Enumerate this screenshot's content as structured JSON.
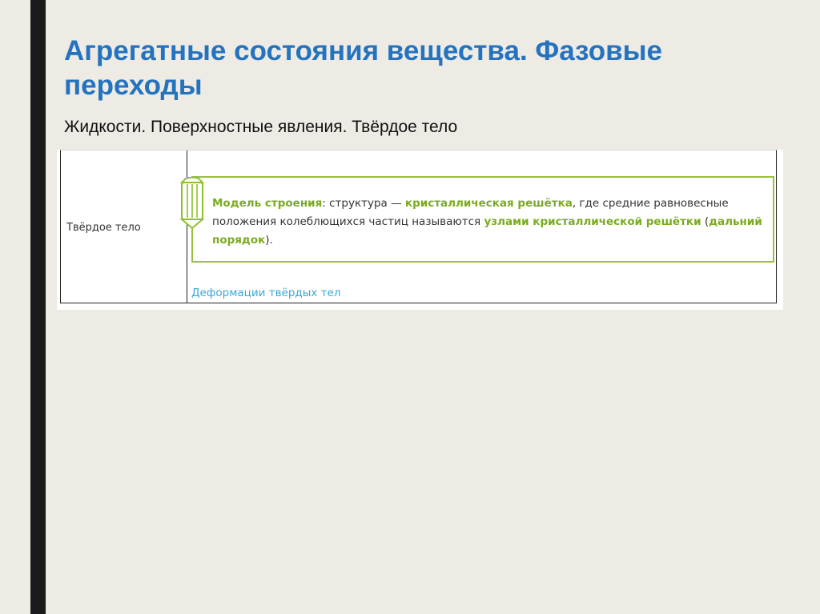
{
  "slide": {
    "title": "Агрегатные состояния вещества. Фазовые переходы",
    "subtitle": "Жидкости. Поверхностные явления. Твёрдое тело"
  },
  "table": {
    "row_label": "Твёрдое тело",
    "note": {
      "icon": "pencil-icon",
      "model_term": "Модель строения",
      "text_1": ": структура — ",
      "crystal_lattice": "кристаллическая решётка",
      "text_2": ", где средние равновесные положения колеблющихся частиц называются ",
      "lattice_nodes": "узлами кристаллической решётки",
      "text_3": " (",
      "long_range_order": "дальний порядок",
      "text_4": ")."
    },
    "link_text": "Деформации твёрдых тел"
  },
  "colors": {
    "title": "#2473bf",
    "accent_green": "#7aab1e",
    "link_blue": "#3aa8d8",
    "left_bar": "#1b1b1b",
    "background": "#eeebe5"
  }
}
